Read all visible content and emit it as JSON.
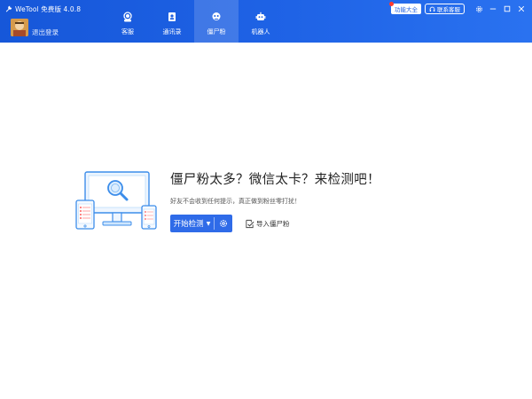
{
  "header": {
    "app_title": "WeTool 免费版 4.0.8",
    "logout_label": "退出登录",
    "tabs": [
      {
        "label": "客服",
        "icon": "customer-service-icon"
      },
      {
        "label": "通讯录",
        "icon": "contacts-icon"
      },
      {
        "label": "僵尸粉",
        "icon": "zombie-icon",
        "active": true
      },
      {
        "label": "机器人",
        "icon": "robot-icon"
      }
    ],
    "func_button": "功能大全",
    "contact_button": "联系客服"
  },
  "main": {
    "title": "僵尸粉太多？微信太卡？来检测吧！",
    "subtitle": "好友不会收到任何提示，真正做到粉丝零打扰！",
    "start_button": "开始检测",
    "import_label": "导入僵尸粉"
  },
  "colors": {
    "header_blue": "#1f5fe0",
    "primary_button": "#2f6be8",
    "illustration_blue": "#3c8dea"
  }
}
